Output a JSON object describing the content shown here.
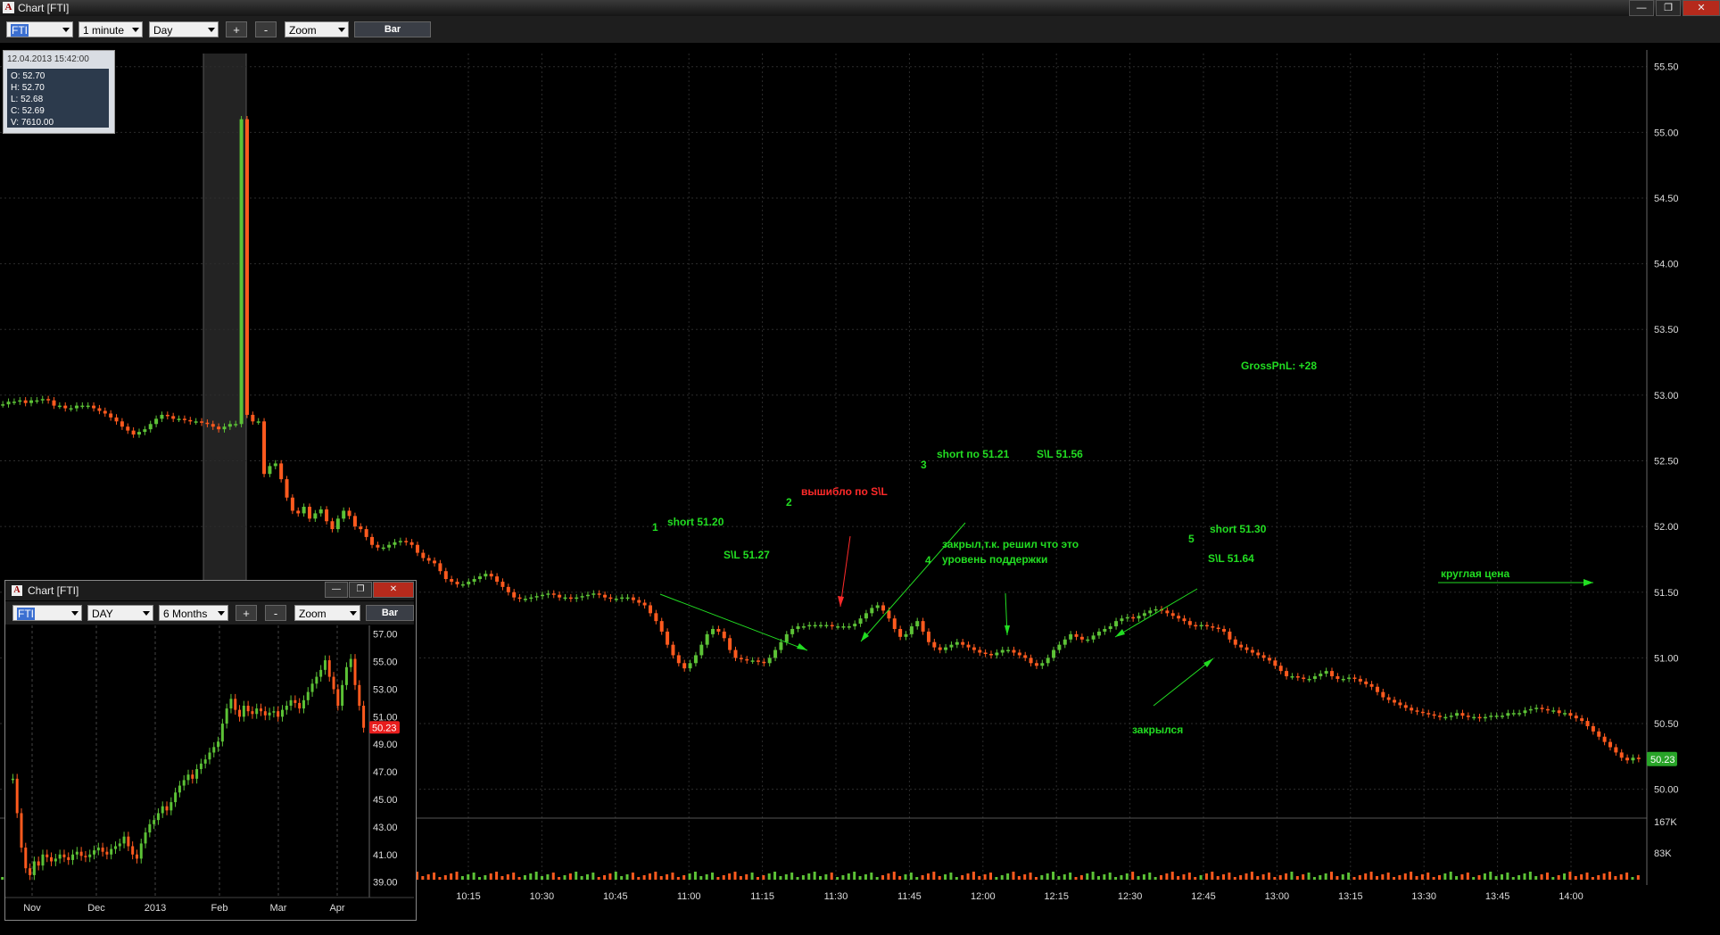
{
  "window": {
    "title": "Chart [FTI]"
  },
  "toolbar": {
    "symbol": "FTI",
    "interval": "1 minute",
    "range": "Day",
    "plus": "+",
    "minus": "-",
    "zoom": "Zoom",
    "bar": "Bar"
  },
  "ohlc": {
    "datetime": "12.04.2013 15:42:00",
    "open": "O: 52.70",
    "high": "H: 52.70",
    "low": "L: 52.68",
    "close": "C: 52.69",
    "volume": "V: 7610.00"
  },
  "annotations": {
    "a1_num": "1",
    "a1_text": "short 51.20",
    "a1_sl": "S\\L 51.27",
    "a2_num": "2",
    "a2_text": "вышибло по S\\L",
    "a3_num": "3",
    "a3_text": "short по 51.21",
    "a3_sl": "S\\L 51.56",
    "a4_num": "4",
    "a4_line1": "закрыл,т.к. решил что это",
    "a4_line2": "уровень поддержки",
    "a5_num": "5",
    "a5_text": "short 51.30",
    "a5_sl": "S\\L 51.64",
    "closed": "закрылся",
    "gross": "GrossPnL: +28",
    "round": "круглая цена"
  },
  "colors": {
    "up": "#5cc236",
    "down": "#ff5a1e",
    "annotation_green": "#22dd22",
    "annotation_red": "#ff2a2a",
    "last_price_bg": "#28a428"
  },
  "chart_data": [
    {
      "type": "bar",
      "title": "",
      "symbol": "FTI",
      "interval": "1 minute",
      "x_ticks": [
        "10:15",
        "10:30",
        "10:45",
        "11:00",
        "11:15",
        "11:30",
        "11:45",
        "12:00",
        "12:15",
        "12:30",
        "12:45",
        "13:00",
        "13:15",
        "13:30",
        "13:45",
        "14:00"
      ],
      "y_ticks": [
        "50.00",
        "50.50",
        "51.00",
        "51.50",
        "52.00",
        "52.50",
        "53.00",
        "53.50",
        "54.00",
        "54.50",
        "55.00",
        "55.50"
      ],
      "ylim": [
        49.95,
        55.6
      ],
      "volume_ticks": [
        "167K",
        "83K"
      ],
      "last_price": "50.23",
      "close_series": [
        52.93,
        52.95,
        52.95,
        52.96,
        52.94,
        52.96,
        52.96,
        52.97,
        52.96,
        52.92,
        52.92,
        52.9,
        52.9,
        52.92,
        52.92,
        52.92,
        52.9,
        52.88,
        52.86,
        52.83,
        52.8,
        52.76,
        52.73,
        52.7,
        52.72,
        52.74,
        52.78,
        52.82,
        52.85,
        52.84,
        52.82,
        52.82,
        52.81,
        52.8,
        52.8,
        52.79,
        52.78,
        52.76,
        52.74,
        52.76,
        52.78,
        52.78,
        55.1,
        52.85,
        52.8,
        52.8,
        52.4,
        52.46,
        52.48,
        52.36,
        52.22,
        52.12,
        52.1,
        52.15,
        52.06,
        52.1,
        52.13,
        52.04,
        51.98,
        52.06,
        52.12,
        52.08,
        52.0,
        51.98,
        51.92,
        51.86,
        51.84,
        51.84,
        51.86,
        51.88,
        51.89,
        51.88,
        51.86,
        51.8,
        51.76,
        51.74,
        51.72,
        51.66,
        51.6,
        51.58,
        51.56,
        51.56,
        51.58,
        51.6,
        51.62,
        51.64,
        51.62,
        51.58,
        51.54,
        51.5,
        51.46,
        51.45,
        51.45,
        51.46,
        51.47,
        51.48,
        51.49,
        51.48,
        51.46,
        51.46,
        51.45,
        51.46,
        51.47,
        51.48,
        51.49,
        51.48,
        51.46,
        51.45,
        51.45,
        51.46,
        51.46,
        51.44,
        51.42,
        51.4,
        51.34,
        51.28,
        51.2,
        51.1,
        51.02,
        50.96,
        50.92,
        50.96,
        51.02,
        51.1,
        51.18,
        51.22,
        51.2,
        51.15,
        51.06,
        51.0,
        50.99,
        50.98,
        50.98,
        50.97,
        50.96,
        51.0,
        51.06,
        51.12,
        51.18,
        51.22,
        51.24,
        51.24,
        51.25,
        51.25,
        51.25,
        51.25,
        51.24,
        51.24,
        51.24,
        51.24,
        51.26,
        51.3,
        51.34,
        51.38,
        51.4,
        51.36,
        51.3,
        51.22,
        51.16,
        51.18,
        51.24,
        51.28,
        51.2,
        51.12,
        51.08,
        51.06,
        51.08,
        51.1,
        51.12,
        51.1,
        51.08,
        51.06,
        51.04,
        51.03,
        51.02,
        51.04,
        51.06,
        51.06,
        51.04,
        51.02,
        51.0,
        50.96,
        50.94,
        50.96,
        51.0,
        51.06,
        51.1,
        51.14,
        51.18,
        51.16,
        51.14,
        51.14,
        51.17,
        51.2,
        51.22,
        51.24,
        51.28,
        51.3,
        51.31,
        51.3,
        51.32,
        51.34,
        51.36,
        51.37,
        51.36,
        51.34,
        51.32,
        51.3,
        51.28,
        51.25,
        51.24,
        51.25,
        51.24,
        51.23,
        51.22,
        51.2,
        51.14,
        51.1,
        51.08,
        51.06,
        51.04,
        51.02,
        51.0,
        50.98,
        50.94,
        50.9,
        50.86,
        50.86,
        50.85,
        50.84,
        50.84,
        50.86,
        50.88,
        50.9,
        50.86,
        50.84,
        50.84,
        50.85,
        50.84,
        50.82,
        50.8,
        50.78,
        50.74,
        50.7,
        50.68,
        50.66,
        50.64,
        50.62,
        50.6,
        50.59,
        50.58,
        50.57,
        50.56,
        50.55,
        50.55,
        50.56,
        50.58,
        50.56,
        50.55,
        50.55,
        50.54,
        50.55,
        50.56,
        50.56,
        50.56,
        50.58,
        50.58,
        50.58,
        50.6,
        50.61,
        50.62,
        50.61,
        50.6,
        50.6,
        50.58,
        50.58,
        50.56,
        50.54,
        50.52,
        50.48,
        50.44,
        50.4,
        50.36,
        50.32,
        50.28,
        50.24,
        50.22,
        50.24,
        50.23
      ]
    },
    {
      "type": "bar",
      "title": "",
      "symbol": "FTI",
      "interval": "DAY",
      "range": "6 Months",
      "x_ticks": [
        "Nov",
        "Dec",
        "2013",
        "Feb",
        "Mar",
        "Apr"
      ],
      "y_ticks": [
        "39.00",
        "41.00",
        "43.00",
        "45.00",
        "47.00",
        "49.00",
        "51.00",
        "53.00",
        "55.00",
        "57.00"
      ],
      "ylim": [
        38.2,
        57.5
      ],
      "last_price": "50.23",
      "close_series": [
        46.5,
        44.0,
        41.5,
        40.0,
        39.5,
        40.5,
        40.2,
        41.0,
        40.8,
        40.5,
        40.7,
        41.0,
        40.8,
        40.6,
        41.0,
        41.2,
        40.9,
        40.8,
        41.0,
        41.3,
        41.5,
        41.2,
        41.0,
        41.4,
        41.6,
        41.8,
        42.3,
        41.6,
        41.0,
        40.7,
        41.8,
        42.6,
        43.2,
        43.5,
        44.0,
        44.5,
        44.2,
        44.8,
        45.5,
        46.0,
        46.4,
        46.8,
        46.5,
        47.2,
        47.6,
        47.9,
        48.4,
        48.8,
        49.2,
        50.5,
        51.6,
        52.3,
        51.5,
        51.0,
        51.8,
        51.4,
        51.2,
        51.6,
        51.4,
        51.1,
        51.3,
        51.4,
        51.0,
        51.5,
        51.8,
        52.2,
        52.0,
        51.6,
        52.2,
        52.8,
        53.4,
        53.9,
        54.4,
        55.1,
        53.9,
        53.0,
        51.8,
        53.3,
        54.6,
        55.2,
        53.3,
        51.8,
        50.2
      ]
    }
  ],
  "inset": {
    "title": "Chart [FTI]",
    "symbol": "FTI",
    "interval": "DAY",
    "range": "6 Months",
    "plus": "+",
    "minus": "-",
    "zoom": "Zoom",
    "bar": "Bar"
  },
  "bottom_prices": [
    "50.19",
    "50.2",
    "50.18",
    "50.18",
    "50.18",
    "50.18",
    "50.2",
    "50.2",
    "50.2",
    "50.2",
    "50.2",
    "50.205",
    "50.2099",
    "50.205",
    "50.21",
    "50.205",
    "50.205",
    "50.21",
    "50.21",
    "50.21",
    "50.21",
    "50.21",
    "50.21",
    "50.21",
    "50.21",
    "50.22",
    "50.215",
    "50.22",
    "50.22",
    "50.22",
    "50.22",
    "50.22",
    "50.23",
    "50.23",
    "50.24",
    "50.23"
  ]
}
